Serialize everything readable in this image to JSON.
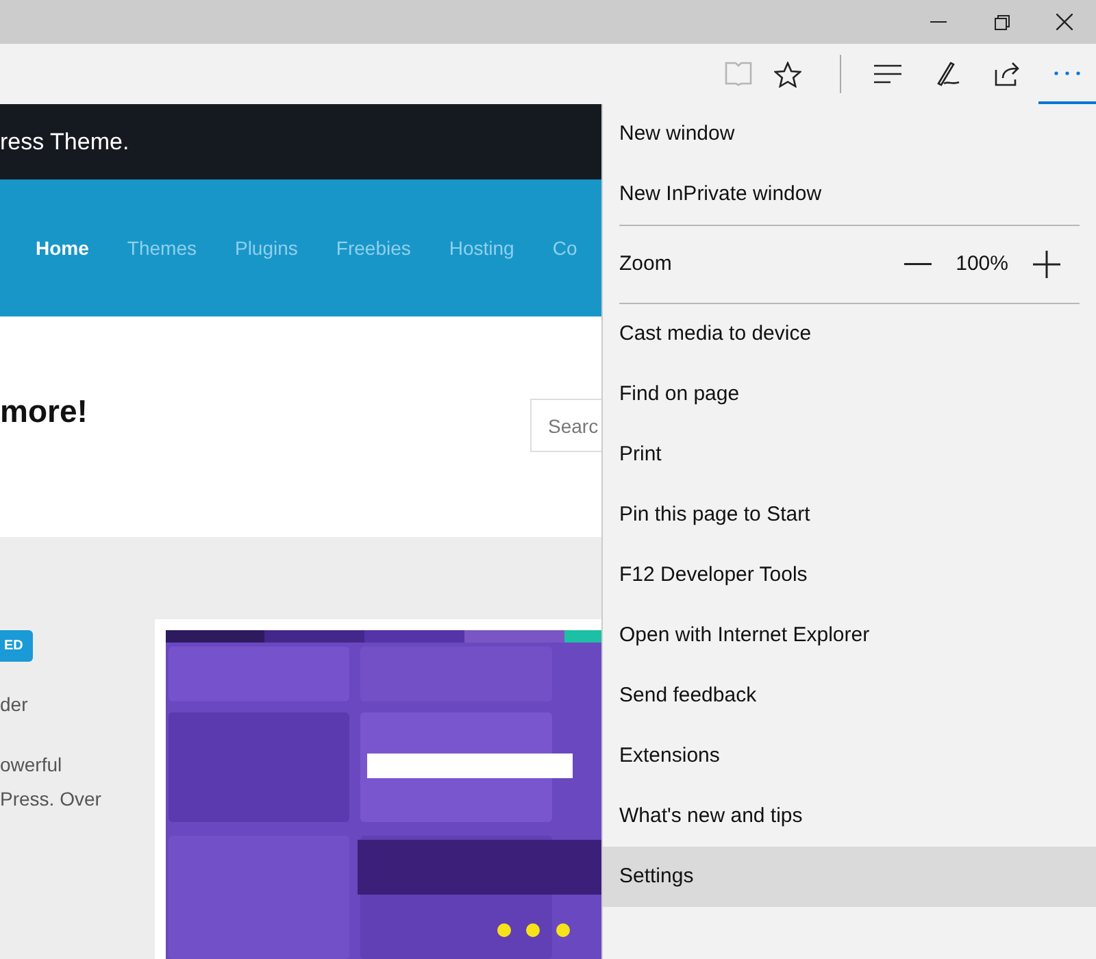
{
  "toolbar": {
    "reading_view_disabled": true,
    "more_active": true
  },
  "page": {
    "banner": "ress Theme.",
    "nav": [
      {
        "label": "Home",
        "selected": true
      },
      {
        "label": "Themes",
        "selected": false
      },
      {
        "label": "Plugins",
        "selected": false
      },
      {
        "label": "Freebies",
        "selected": false
      },
      {
        "label": "Hosting",
        "selected": false
      },
      {
        "label": "Co",
        "selected": false
      }
    ],
    "heading": "more!",
    "search": {
      "placeholder": "Searc"
    },
    "badge": "ED",
    "text_lines": [
      "der",
      "owerful",
      "Press. Over"
    ]
  },
  "menu": [
    {
      "kind": "item",
      "label": "New window",
      "selected": false
    },
    {
      "kind": "item",
      "label": "New InPrivate window",
      "selected": false
    },
    {
      "kind": "separator"
    },
    {
      "kind": "zoom",
      "label": "Zoom",
      "value": "100%"
    },
    {
      "kind": "separator"
    },
    {
      "kind": "item",
      "label": "Cast media to device",
      "selected": false
    },
    {
      "kind": "item",
      "label": "Find on page",
      "selected": false
    },
    {
      "kind": "item",
      "label": "Print",
      "selected": false
    },
    {
      "kind": "item",
      "label": "Pin this page to Start",
      "selected": false
    },
    {
      "kind": "item",
      "label": "F12 Developer Tools",
      "selected": false
    },
    {
      "kind": "item",
      "label": "Open with Internet Explorer",
      "selected": false
    },
    {
      "kind": "item",
      "label": "Send feedback",
      "selected": false
    },
    {
      "kind": "item",
      "label": "Extensions",
      "selected": false
    },
    {
      "kind": "item",
      "label": "What's new and tips",
      "selected": false
    },
    {
      "kind": "item",
      "label": "Settings",
      "selected": true
    }
  ]
}
